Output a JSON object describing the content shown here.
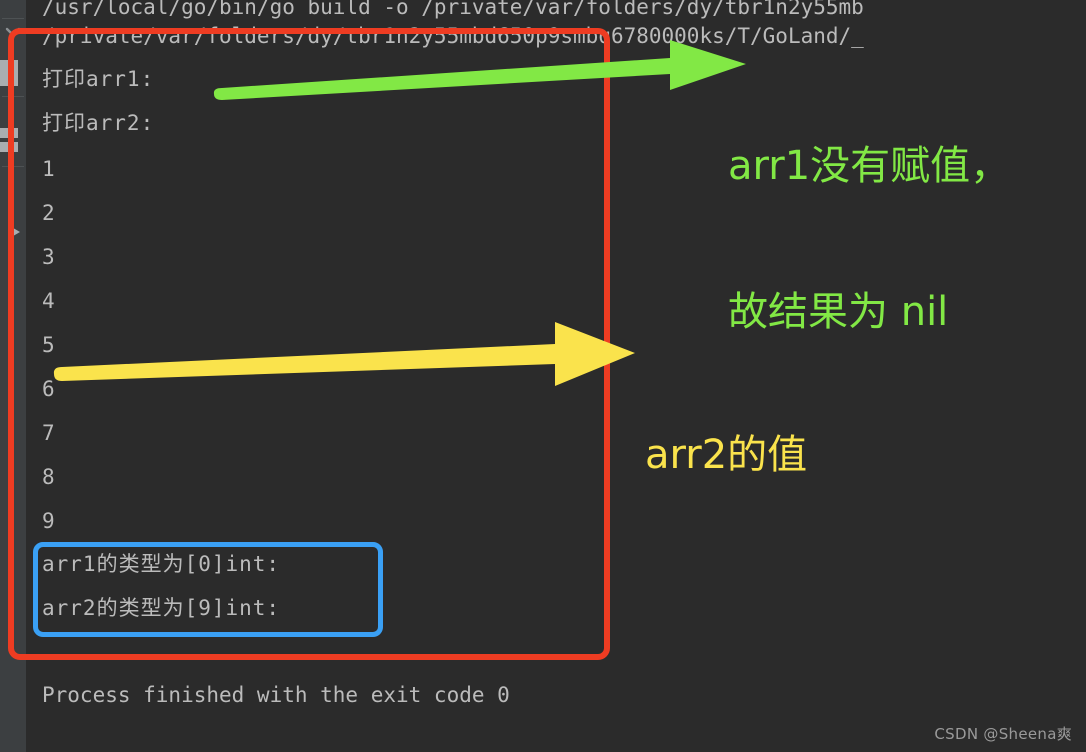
{
  "window": {
    "background_color": "#2b2b2b",
    "gutter_color": "#3c3f41"
  },
  "gutter": {
    "icons": [
      {
        "name": "rerun-icon",
        "label": "▼"
      },
      {
        "name": "stop-icon",
        "label": "■"
      },
      {
        "name": "print-icon",
        "label": "≣"
      },
      {
        "name": "resume-icon",
        "label": "▶"
      }
    ]
  },
  "console": {
    "lines": [
      {
        "text": "/usr/local/go/bin/go build -o /private/var/folders/dy/tbr1n2y55mb",
        "mono": true
      },
      {
        "text": "/private/var/folders/dy/tbr1n2y55mbd650p9smbq6780000ks/T/GoLand/_",
        "mono": true
      },
      {
        "text": "打印arr1:",
        "mono": false
      },
      {
        "text": "打印arr2:",
        "mono": false
      },
      {
        "text": "1",
        "mono": true
      },
      {
        "text": "2",
        "mono": true
      },
      {
        "text": "3",
        "mono": true
      },
      {
        "text": "4",
        "mono": true
      },
      {
        "text": "5",
        "mono": true
      },
      {
        "text": "6",
        "mono": true
      },
      {
        "text": "7",
        "mono": true
      },
      {
        "text": "8",
        "mono": true
      },
      {
        "text": "9",
        "mono": true
      },
      {
        "text": "arr1的类型为[0]int:",
        "mono": false
      },
      {
        "text": "arr2的类型为[9]int:",
        "mono": false
      },
      {
        "text": "Process finished with the exit code 0",
        "mono": true
      }
    ]
  },
  "annotations": {
    "red_box": {
      "label": "red-highlight-box",
      "color": "#ee3c22"
    },
    "blue_box": {
      "label": "blue-highlight-box",
      "color": "#3aa0f5"
    },
    "green": {
      "color": "#82e845",
      "line1": "arr1没有赋值，",
      "line2": "故结果为 nil"
    },
    "yellow": {
      "color": "#fae34c",
      "line1": "arr2的值"
    }
  },
  "watermark": {
    "text": "CSDN @Sheena爽"
  }
}
